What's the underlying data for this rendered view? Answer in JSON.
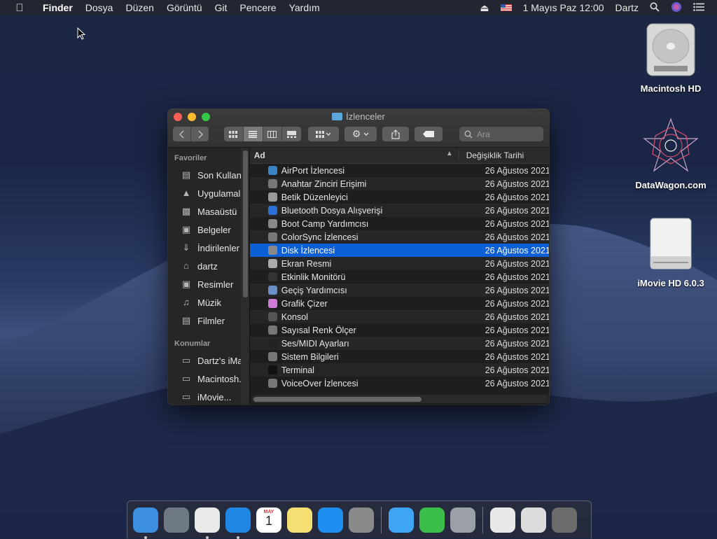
{
  "menubar": {
    "apple_icon": "apple-icon",
    "app_name": "Finder",
    "items": [
      "Dosya",
      "Düzen",
      "Görüntü",
      "Git",
      "Pencere",
      "Yardım"
    ],
    "datetime": "1 Mayıs Paz  12:00",
    "user": "Dartz"
  },
  "desktop": {
    "icons": [
      {
        "label": "Macintosh HD",
        "icon": "hard-drive-icon"
      },
      {
        "label": "DataWagon.com",
        "icon": "star-pattern-icon"
      },
      {
        "label": "iMovie HD 6.0.3",
        "icon": "disk-image-icon"
      }
    ]
  },
  "window": {
    "title": "İzlenceler",
    "search_placeholder": "Ara",
    "sidebar": {
      "favorites_header": "Favoriler",
      "favorites": [
        {
          "label": "Son Kullan...",
          "icon": "recents-icon"
        },
        {
          "label": "Uygulamalar",
          "icon": "applications-icon"
        },
        {
          "label": "Masaüstü",
          "icon": "desktop-icon"
        },
        {
          "label": "Belgeler",
          "icon": "documents-icon"
        },
        {
          "label": "İndirilenler",
          "icon": "downloads-icon"
        },
        {
          "label": "dartz",
          "icon": "home-icon"
        },
        {
          "label": "Resimler",
          "icon": "pictures-icon"
        },
        {
          "label": "Müzik",
          "icon": "music-icon"
        },
        {
          "label": "Filmler",
          "icon": "movies-icon"
        }
      ],
      "locations_header": "Konumlar",
      "locations": [
        {
          "label": "Dartz's iMac",
          "icon": "computer-icon"
        },
        {
          "label": "Macintosh...",
          "icon": "drive-icon"
        },
        {
          "label": "iMovie...",
          "icon": "drive-icon"
        }
      ]
    },
    "columns": {
      "name": "Ad",
      "date": "Değişiklik Tarihi"
    },
    "rows": [
      {
        "name": "AirPort İzlencesi",
        "date": "26 Ağustos 2021",
        "color": "#3b82c4"
      },
      {
        "name": "Anahtar Zinciri Erişimi",
        "date": "26 Ağustos 2021",
        "color": "#777777"
      },
      {
        "name": "Betik Düzenleyici",
        "date": "26 Ağustos 2021",
        "color": "#999999"
      },
      {
        "name": "Bluetooth Dosya Alışverişi",
        "date": "26 Ağustos 2021",
        "color": "#2d6fd6"
      },
      {
        "name": "Boot Camp Yardımcısı",
        "date": "26 Ağustos 2021",
        "color": "#888888"
      },
      {
        "name": "ColorSync İzlencesi",
        "date": "26 Ağustos 2021",
        "color": "#777777"
      },
      {
        "name": "Disk İzlencesi",
        "date": "26 Ağustos 2021",
        "color": "#8a8a8a"
      },
      {
        "name": "Ekran Resmi",
        "date": "26 Ağustos 2021",
        "color": "#aaaaaa"
      },
      {
        "name": "Etkinlik Monitörü",
        "date": "26 Ağustos 2021",
        "color": "#333333"
      },
      {
        "name": "Geçiş Yardımcısı",
        "date": "26 Ağustos 2021",
        "color": "#6a8fc7"
      },
      {
        "name": "Grafik Çizer",
        "date": "26 Ağustos 2021",
        "color": "#d07bd8"
      },
      {
        "name": "Konsol",
        "date": "26 Ağustos 2021",
        "color": "#555555"
      },
      {
        "name": "Sayısal Renk Ölçer",
        "date": "26 Ağustos 2021",
        "color": "#777777"
      },
      {
        "name": "Ses/MIDI Ayarları",
        "date": "26 Ağustos 2021",
        "color": "#222222"
      },
      {
        "name": "Sistem Bilgileri",
        "date": "26 Ağustos 2021",
        "color": "#777777"
      },
      {
        "name": "Terminal",
        "date": "26 Ağustos 2021",
        "color": "#111111"
      },
      {
        "name": "VoiceOver İzlencesi",
        "date": "26 Ağustos 2021",
        "color": "#777777"
      }
    ],
    "selected_row": "Disk İzlencesi"
  },
  "dock": {
    "apps": [
      {
        "name": "finder",
        "icon": "finder-icon",
        "color": "#3d8fe0",
        "running": true
      },
      {
        "name": "launchpad",
        "icon": "launchpad-icon",
        "color": "#6f7885",
        "running": false
      },
      {
        "name": "chrome",
        "icon": "chrome-icon",
        "color": "#e9e9e9",
        "running": true
      },
      {
        "name": "safari",
        "icon": "safari-icon",
        "color": "#1f87e4",
        "running": true
      },
      {
        "name": "calendar",
        "icon": "calendar-icon",
        "color": "#ffffff",
        "running": false
      },
      {
        "name": "notes",
        "icon": "notes-icon",
        "color": "#f6df72",
        "running": false
      },
      {
        "name": "app-store",
        "icon": "app-store-icon",
        "color": "#1c8ff0",
        "running": false
      },
      {
        "name": "system-preferences",
        "icon": "system-preferences-icon",
        "color": "#8a8a8a",
        "running": false
      },
      {
        "name": "messages",
        "icon": "messages-icon",
        "color": "#3ea5f5",
        "running": false
      },
      {
        "name": "facetime",
        "icon": "facetime-icon",
        "color": "#3bbf4a",
        "running": false
      },
      {
        "name": "disk-utility",
        "icon": "disk-utility-icon",
        "color": "#9aa0a6",
        "running": false
      },
      {
        "name": "preview",
        "icon": "preview-icon",
        "color": "#e8e8e8",
        "running": false
      },
      {
        "name": "document",
        "icon": "document-icon",
        "color": "#dcdcdc",
        "running": false
      },
      {
        "name": "trash",
        "icon": "trash-icon",
        "color": "#6b6b6b",
        "running": false
      }
    ],
    "calendar_month": "MAY",
    "calendar_day": "1"
  }
}
